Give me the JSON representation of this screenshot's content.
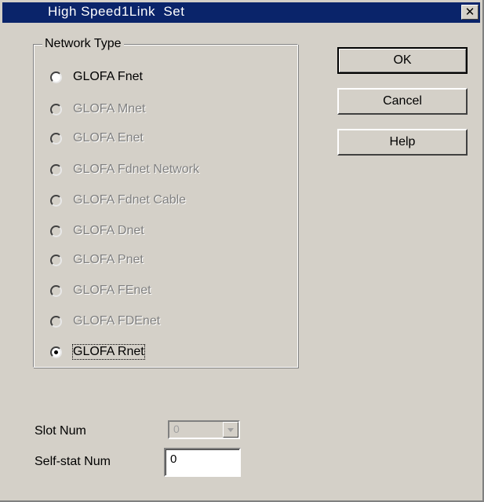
{
  "window": {
    "title": "High Speed1Link  Set",
    "close_label": "✕"
  },
  "network_group": {
    "legend": "Network Type",
    "options": [
      {
        "label": "GLOFA Fnet",
        "enabled": true,
        "checked": false
      },
      {
        "label": "GLOFA Mnet",
        "enabled": false,
        "checked": false
      },
      {
        "label": "GLOFA Enet",
        "enabled": false,
        "checked": false
      },
      {
        "label": "GLOFA Fdnet Network",
        "enabled": false,
        "checked": false
      },
      {
        "label": "GLOFA Fdnet Cable",
        "enabled": false,
        "checked": false
      },
      {
        "label": "GLOFA Dnet",
        "enabled": false,
        "checked": false
      },
      {
        "label": "GLOFA Pnet",
        "enabled": false,
        "checked": false
      },
      {
        "label": "GLOFA FEnet",
        "enabled": false,
        "checked": false
      },
      {
        "label": "GLOFA FDEnet",
        "enabled": false,
        "checked": false
      },
      {
        "label": "GLOFA Rnet",
        "enabled": true,
        "checked": true
      }
    ]
  },
  "buttons": {
    "ok": "OK",
    "cancel": "Cancel",
    "help": "Help"
  },
  "slot": {
    "label": "Slot Num",
    "value": "0"
  },
  "self_stat": {
    "label": "Self-stat Num",
    "value": "0"
  },
  "colors": {
    "titlebar": "#0a246a",
    "face": "#d4d0c8",
    "disabled_text": "#808080"
  }
}
